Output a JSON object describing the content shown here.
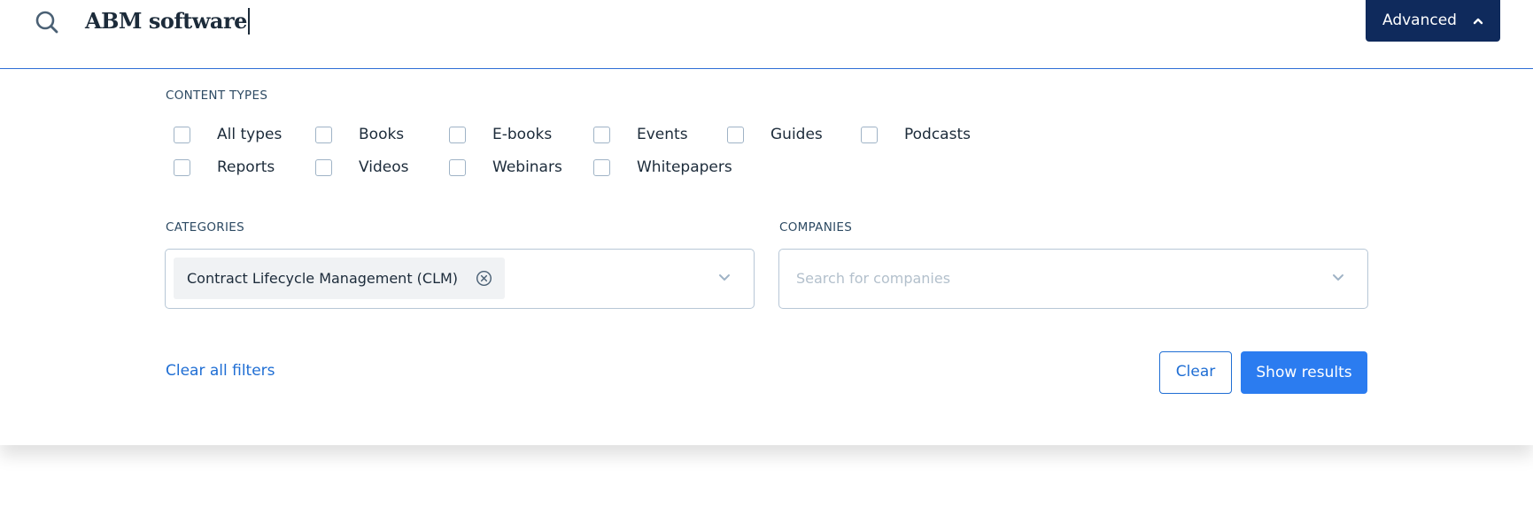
{
  "search": {
    "query": "ABM software"
  },
  "advanced_button": {
    "label": "Advanced",
    "expanded": true
  },
  "content_types": {
    "label": "CONTENT TYPES",
    "options": [
      {
        "label": "All types",
        "checked": false
      },
      {
        "label": "Books",
        "checked": false
      },
      {
        "label": "E-books",
        "checked": false
      },
      {
        "label": "Events",
        "checked": false
      },
      {
        "label": "Guides",
        "checked": false
      },
      {
        "label": "Podcasts",
        "checked": false
      },
      {
        "label": "Reports",
        "checked": false
      },
      {
        "label": "Videos",
        "checked": false
      },
      {
        "label": "Webinars",
        "checked": false
      },
      {
        "label": "Whitepapers",
        "checked": false
      }
    ]
  },
  "categories": {
    "label": "CATEGORIES",
    "selected": [
      "Contract Lifecycle Management (CLM)"
    ]
  },
  "companies": {
    "label": "COMPANIES",
    "placeholder": "Search for companies"
  },
  "actions": {
    "clear_all_label": "Clear all filters",
    "clear_label": "Clear",
    "show_results_label": "Show results"
  },
  "colors": {
    "advanced_bg": "#0f2a5c",
    "primary": "#2b7cf0",
    "link": "#1f6ed4",
    "divider": "#2f6fd8"
  }
}
